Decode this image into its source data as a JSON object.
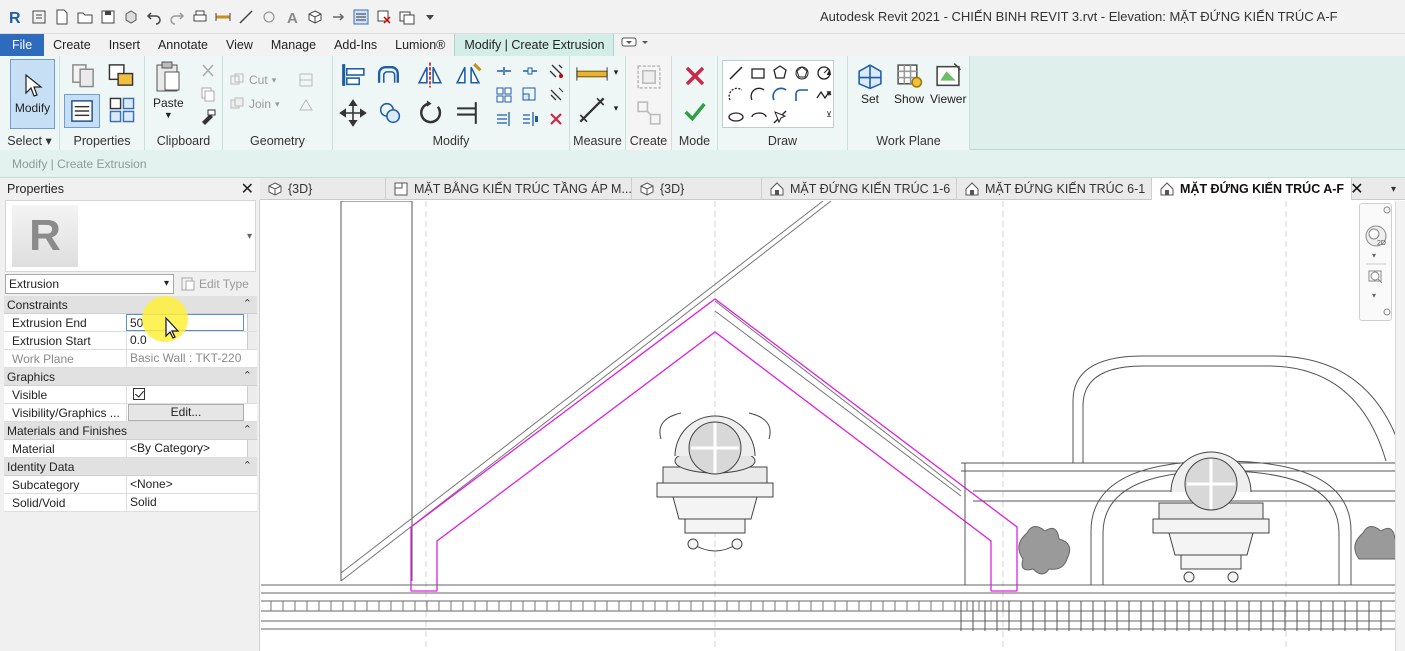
{
  "window": {
    "title": "Autodesk Revit 2021 - CHIẾN BINH REVIT 3.rvt - Elevation: MẶT ĐỨNG KIẾN TRÚC A-F"
  },
  "quick_access_icons": [
    "revit-logo-icon",
    "open-icon",
    "new-icon",
    "folder-icon",
    "save-icon",
    "sync-icon",
    "undo-icon",
    "redo-icon",
    "print-icon",
    "measure-icon",
    "dimension-icon",
    "tag-icon",
    "text-icon",
    "3d-view-icon",
    "section-icon",
    "thin-lines-icon",
    "close-hidden-icon",
    "switch-windows-icon",
    "customize-icon"
  ],
  "ribbon_tabs": [
    {
      "label": "File",
      "kind": "file"
    },
    {
      "label": "Create",
      "kind": "normal"
    },
    {
      "label": "Insert",
      "kind": "normal"
    },
    {
      "label": "Annotate",
      "kind": "normal"
    },
    {
      "label": "View",
      "kind": "normal"
    },
    {
      "label": "Manage",
      "kind": "normal"
    },
    {
      "label": "Add-Ins",
      "kind": "normal"
    },
    {
      "label": "Lumion®",
      "kind": "normal"
    },
    {
      "label": "Modify | Create Extrusion",
      "kind": "contextual"
    }
  ],
  "ribbon": {
    "select": {
      "panel_label": "Select ▾",
      "modify_label": "Modify"
    },
    "properties": {
      "panel_label": "Properties"
    },
    "clipboard": {
      "panel_label": "Clipboard",
      "paste_label": "Paste"
    },
    "geometry": {
      "panel_label": "Geometry",
      "cut_label": "Cut",
      "join_label": "Join"
    },
    "modify": {
      "panel_label": "Modify"
    },
    "measure": {
      "panel_label": "Measure"
    },
    "create": {
      "panel_label": "Create"
    },
    "mode": {
      "panel_label": "Mode"
    },
    "draw": {
      "panel_label": "Draw"
    },
    "workplane": {
      "panel_label": "Work Plane",
      "set_label": "Set",
      "show_label": "Show",
      "viewer_label": "Viewer"
    }
  },
  "options_bar": {
    "text": "Modify | Create Extrusion"
  },
  "properties_palette": {
    "title": "Properties",
    "type_selector": "Extrusion",
    "edit_type_label": "Edit Type",
    "groups": [
      {
        "name": "Constraints",
        "rows": [
          {
            "key": "Extrusion End",
            "value": "50"
          },
          {
            "key": "Extrusion Start",
            "value": "0.0"
          },
          {
            "key": "Work Plane",
            "value": "Basic Wall : TKT-220"
          }
        ]
      },
      {
        "name": "Graphics",
        "rows": [
          {
            "key": "Visible",
            "value": ""
          },
          {
            "key": "Visibility/Graphics ...",
            "value": "Edit..."
          }
        ]
      },
      {
        "name": "Materials and Finishes",
        "rows": [
          {
            "key": "Material",
            "value": "<By Category>"
          }
        ]
      },
      {
        "name": "Identity Data",
        "rows": [
          {
            "key": "Subcategory",
            "value": "<None>"
          },
          {
            "key": "Solid/Void",
            "value": "Solid"
          }
        ]
      }
    ]
  },
  "view_tabs": [
    {
      "label": "{3D}",
      "icon": "3d-view-icon",
      "active": false
    },
    {
      "label": "MẶT BẰNG KIẾN TRÚC TẦNG ÁP M...",
      "icon": "floor-plan-icon",
      "active": false
    },
    {
      "label": "{3D}",
      "icon": "3d-view-icon",
      "active": false
    },
    {
      "label": "MẶT ĐỨNG KIẾN TRÚC 1-6",
      "icon": "elevation-icon",
      "active": false
    },
    {
      "label": "MẶT ĐỨNG KIẾN TRÚC 6-1",
      "icon": "elevation-icon",
      "active": false
    },
    {
      "label": "MẶT ĐỨNG KIẾN TRÚC A-F",
      "icon": "elevation-icon",
      "active": true
    }
  ],
  "colors": {
    "accent_file_tab": "#2e6bbd",
    "contextual_tab": "#d3ede7",
    "sketch_lines": "#e020e0",
    "cursor_highlight": "#fff03c"
  }
}
